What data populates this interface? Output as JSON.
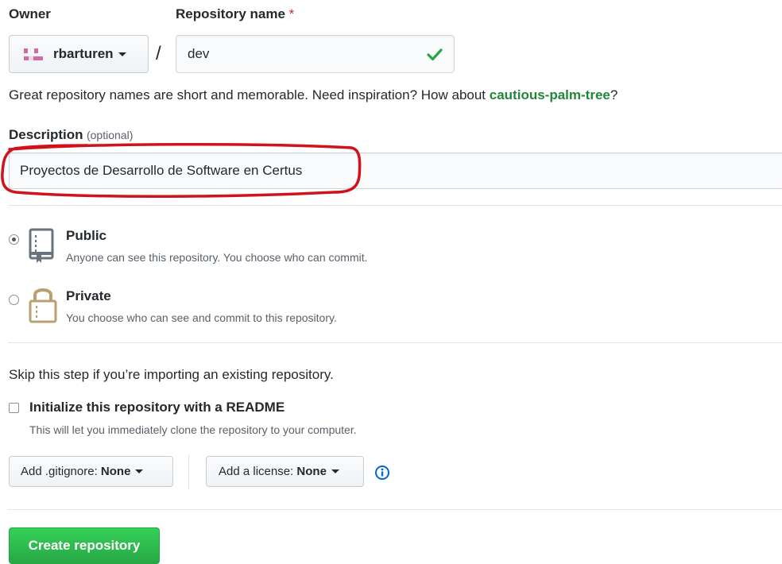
{
  "owner": {
    "label": "Owner",
    "value": "rbarturen"
  },
  "repo_name": {
    "label": "Repository name",
    "required_mark": "*",
    "value": "dev",
    "separator": "/"
  },
  "name_hint": {
    "text": "Great repository names are short and memorable. Need inspiration? How about ",
    "suggestion": "cautious-palm-tree",
    "suffix": "?"
  },
  "description": {
    "label": "Description",
    "optional": "(optional)",
    "value": "Proyectos de Desarrollo de Software en Certus"
  },
  "visibility": {
    "public": {
      "label": "Public",
      "desc": "Anyone can see this repository. You choose who can commit.",
      "selected": true
    },
    "private": {
      "label": "Private",
      "desc": "You choose who can see and commit to this repository.",
      "selected": false
    }
  },
  "init": {
    "skip_text": "Skip this step if you’re importing an existing repository.",
    "readme_label": "Initialize this repository with a README",
    "readme_desc": "This will let you immediately clone the repository to your computer.",
    "readme_checked": false
  },
  "gitignore": {
    "prefix": "Add .gitignore:",
    "value": "None"
  },
  "license": {
    "prefix": "Add a license:",
    "value": "None"
  },
  "create_button": "Create repository",
  "colors": {
    "accent_green": "#2cbe4e",
    "suggestion_green": "#22863a",
    "annotation_red": "#d0121b",
    "info_blue": "#0366d6"
  }
}
